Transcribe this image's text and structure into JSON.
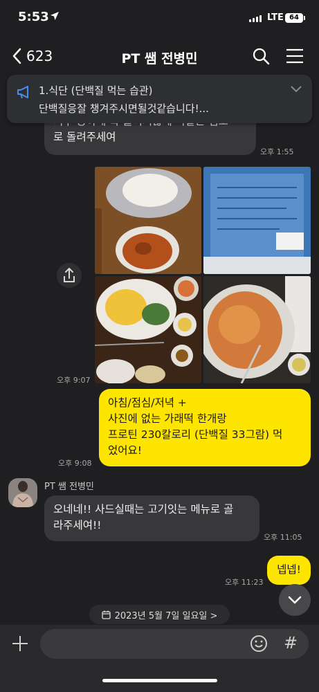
{
  "status": {
    "time": "5:53",
    "network": "LTE",
    "battery": "64"
  },
  "header": {
    "back_count": "623",
    "title": "PT 쌤 전병민"
  },
  "notice": {
    "title": "1.식단 (단백질 먹는 습관)",
    "body": "단백질응잘 챙겨주시면될것같습니다!..."
  },
  "messages": {
    "m1": {
      "line1": "너무 농하게 확 늘리시않게 똑같은 템포",
      "line2": "로 돌려주세여",
      "time": "오후 1:55"
    },
    "photos": {
      "time": "오후 9:07"
    },
    "m2": {
      "line1": "아침/점심/저녁 +",
      "line2": "사진에 없는 가래떡 한개랑",
      "line3": "프로틴 230칼로리 (단백질 33그람) 먹",
      "line4": "었어요!",
      "time": "오후 9:08"
    },
    "sender": "PT 쌤 전병민",
    "m3": {
      "line1": "오네네!! 사드실때는 고기잇는 메뉴로 골",
      "line2": "라주세여!!",
      "time": "오후 11:05"
    },
    "m4": {
      "text": "넵넵!",
      "time": "오후 11:23"
    }
  },
  "date_divider": "2023년 5월 7일 일요일 >",
  "colors": {
    "background": "#1f1f21",
    "my_bubble": "#fee500",
    "their_bubble": "#38383b"
  },
  "icons": [
    "back-icon",
    "search-icon",
    "menu-icon",
    "megaphone-icon",
    "chevron-down-icon",
    "share-icon",
    "plus-icon",
    "emoji-icon",
    "hash-icon",
    "calendar-icon"
  ]
}
